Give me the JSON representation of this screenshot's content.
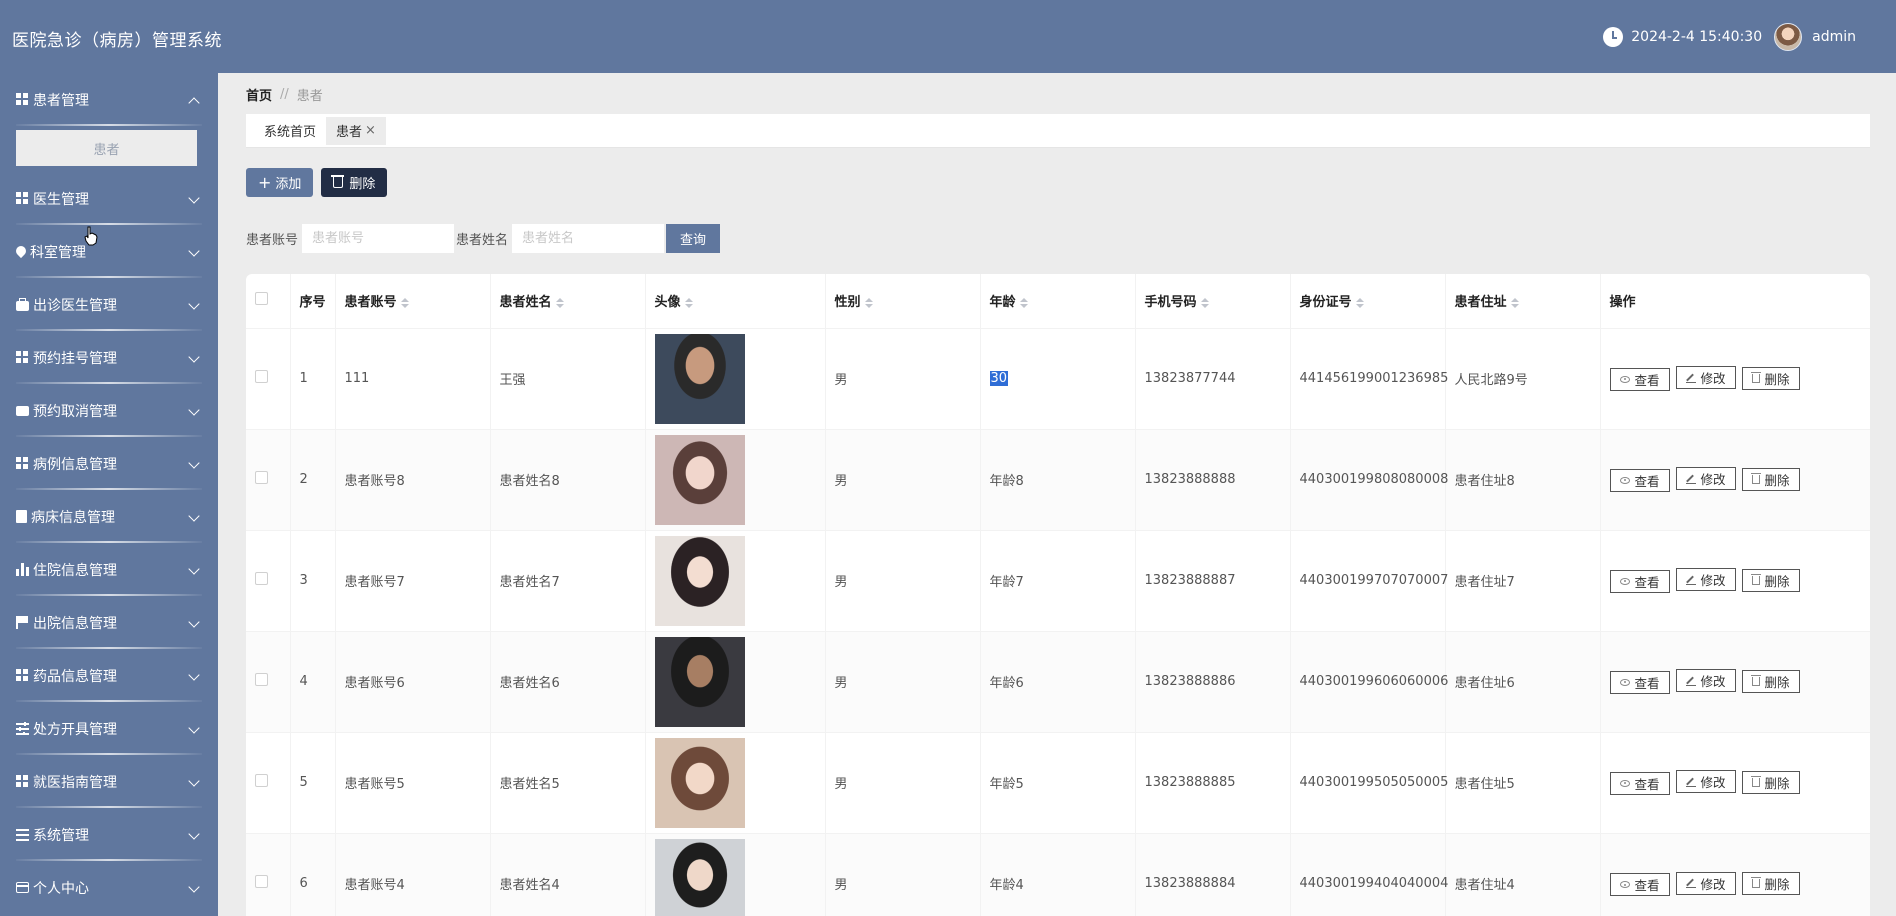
{
  "app": {
    "title": "医院急诊（病房）管理系统"
  },
  "header": {
    "datetime": "2024-2-4 15:40:30",
    "username": "admin"
  },
  "sidebar": {
    "items": [
      {
        "label": "患者管理",
        "icon": "grid-icon",
        "expanded": true,
        "sub": [
          "患者"
        ]
      },
      {
        "label": "医生管理",
        "icon": "grid-icon"
      },
      {
        "label": "科室管理",
        "icon": "location-icon"
      },
      {
        "label": "出诊医生管理",
        "icon": "briefcase-icon"
      },
      {
        "label": "预约挂号管理",
        "icon": "grid-icon"
      },
      {
        "label": "预约取消管理",
        "icon": "chat-icon"
      },
      {
        "label": "病例信息管理",
        "icon": "grid-icon"
      },
      {
        "label": "病床信息管理",
        "icon": "clipboard-icon"
      },
      {
        "label": "住院信息管理",
        "icon": "bar-chart-icon"
      },
      {
        "label": "出院信息管理",
        "icon": "flag-icon"
      },
      {
        "label": "药品信息管理",
        "icon": "grid-icon"
      },
      {
        "label": "处方开具管理",
        "icon": "sliders-icon"
      },
      {
        "label": "就医指南管理",
        "icon": "grid-icon"
      },
      {
        "label": "系统管理",
        "icon": "list-icon"
      },
      {
        "label": "个人中心",
        "icon": "card-icon"
      }
    ]
  },
  "breadcrumb": {
    "home": "首页",
    "separator": "//",
    "current": "患者"
  },
  "tabs": [
    {
      "label": "系统首页"
    },
    {
      "label": "患者",
      "close": "×"
    }
  ],
  "toolbar": {
    "add_label": "添加",
    "delete_label": "删除"
  },
  "search": {
    "account_label": "患者账号",
    "account_placeholder": "患者账号",
    "name_label": "患者姓名",
    "name_placeholder": "患者姓名",
    "query_label": "查询"
  },
  "table": {
    "headers": [
      "序号",
      "患者账号",
      "患者姓名",
      "头像",
      "性别",
      "年龄",
      "手机号码",
      "身份证号",
      "患者住址",
      "操作"
    ],
    "actions": {
      "view": "查看",
      "edit": "修改",
      "delete": "删除"
    },
    "rows": [
      {
        "no": "1",
        "account": "111",
        "name": "王强",
        "gender": "男",
        "age": "30",
        "phone": "13823877744",
        "idcard": "441456199001236985",
        "address": "人民北路9号"
      },
      {
        "no": "2",
        "account": "患者账号8",
        "name": "患者姓名8",
        "gender": "男",
        "age": "年龄8",
        "phone": "13823888888",
        "idcard": "440300199808080008",
        "address": "患者住址8"
      },
      {
        "no": "3",
        "account": "患者账号7",
        "name": "患者姓名7",
        "gender": "男",
        "age": "年龄7",
        "phone": "13823888887",
        "idcard": "440300199707070007",
        "address": "患者住址7"
      },
      {
        "no": "4",
        "account": "患者账号6",
        "name": "患者姓名6",
        "gender": "男",
        "age": "年龄6",
        "phone": "13823888886",
        "idcard": "440300199606060006",
        "address": "患者住址6"
      },
      {
        "no": "5",
        "account": "患者账号5",
        "name": "患者姓名5",
        "gender": "男",
        "age": "年龄5",
        "phone": "13823888885",
        "idcard": "440300199505050005",
        "address": "患者住址5"
      },
      {
        "no": "6",
        "account": "患者账号4",
        "name": "患者姓名4",
        "gender": "男",
        "age": "年龄4",
        "phone": "13823888884",
        "idcard": "440300199404040004",
        "address": "患者住址4"
      }
    ]
  },
  "colors": {
    "primary": "#60779e",
    "dark": "#222d45",
    "background": "#ececec"
  }
}
